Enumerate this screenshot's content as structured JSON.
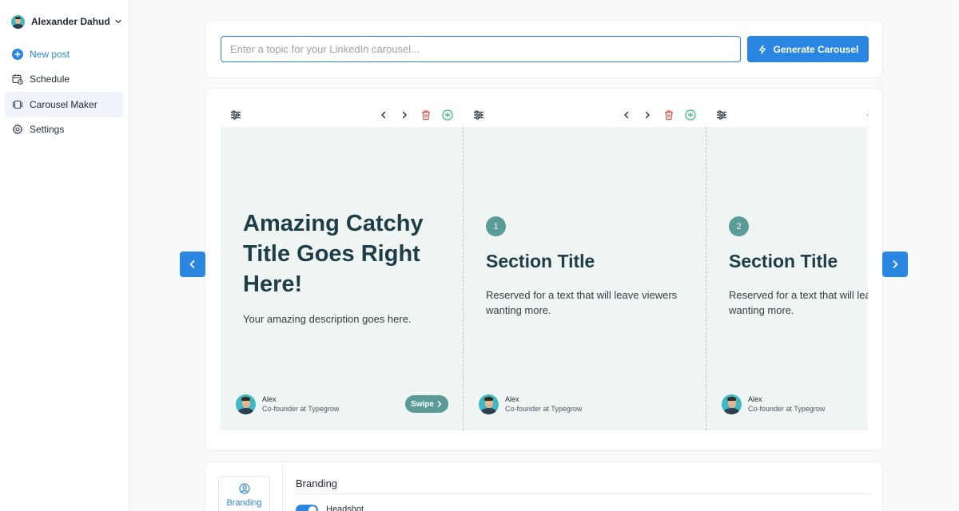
{
  "sidebar": {
    "user_name": "Alexander Dahud",
    "items": [
      {
        "label": "New post",
        "icon": "plus-circle-icon"
      },
      {
        "label": "Schedule",
        "icon": "calendar-clock-icon"
      },
      {
        "label": "Carousel Maker",
        "icon": "carousel-icon"
      },
      {
        "label": "Settings",
        "icon": "gear-icon"
      }
    ],
    "active_item": "Carousel Maker"
  },
  "generator": {
    "placeholder": "Enter a topic for your LinkedIn carousel...",
    "value": "",
    "button_label": "Generate Carousel"
  },
  "slides": [
    {
      "type": "intro",
      "title": "Amazing Catchy Title Goes Right Here!",
      "description": "Your amazing description goes here.",
      "swipe_label": "Swipe",
      "author_name": "Alex",
      "author_role": "Co-founder at Typegrow"
    },
    {
      "type": "section",
      "number": "1",
      "title": "Section Title",
      "text": "Reserved for a text that will leave viewers wanting more.",
      "author_name": "Alex",
      "author_role": "Co-founder at Typegrow"
    },
    {
      "type": "section",
      "number": "2",
      "title": "Section Title",
      "text": "Reserved for a text that will leave viewers wanting more.",
      "author_name": "Alex",
      "author_role": "Co-founder at Typegrow"
    }
  ],
  "settings_panel": {
    "tab_label": "Branding",
    "title": "Branding",
    "headshot_label": "Headshot",
    "headshot_enabled": true
  },
  "colors": {
    "primary": "#2a86e0",
    "slide_bg": "#eef5f3",
    "accent": "#5a9a97",
    "delete": "#e05555",
    "add": "#2bb673",
    "heading": "#1f3d46"
  }
}
